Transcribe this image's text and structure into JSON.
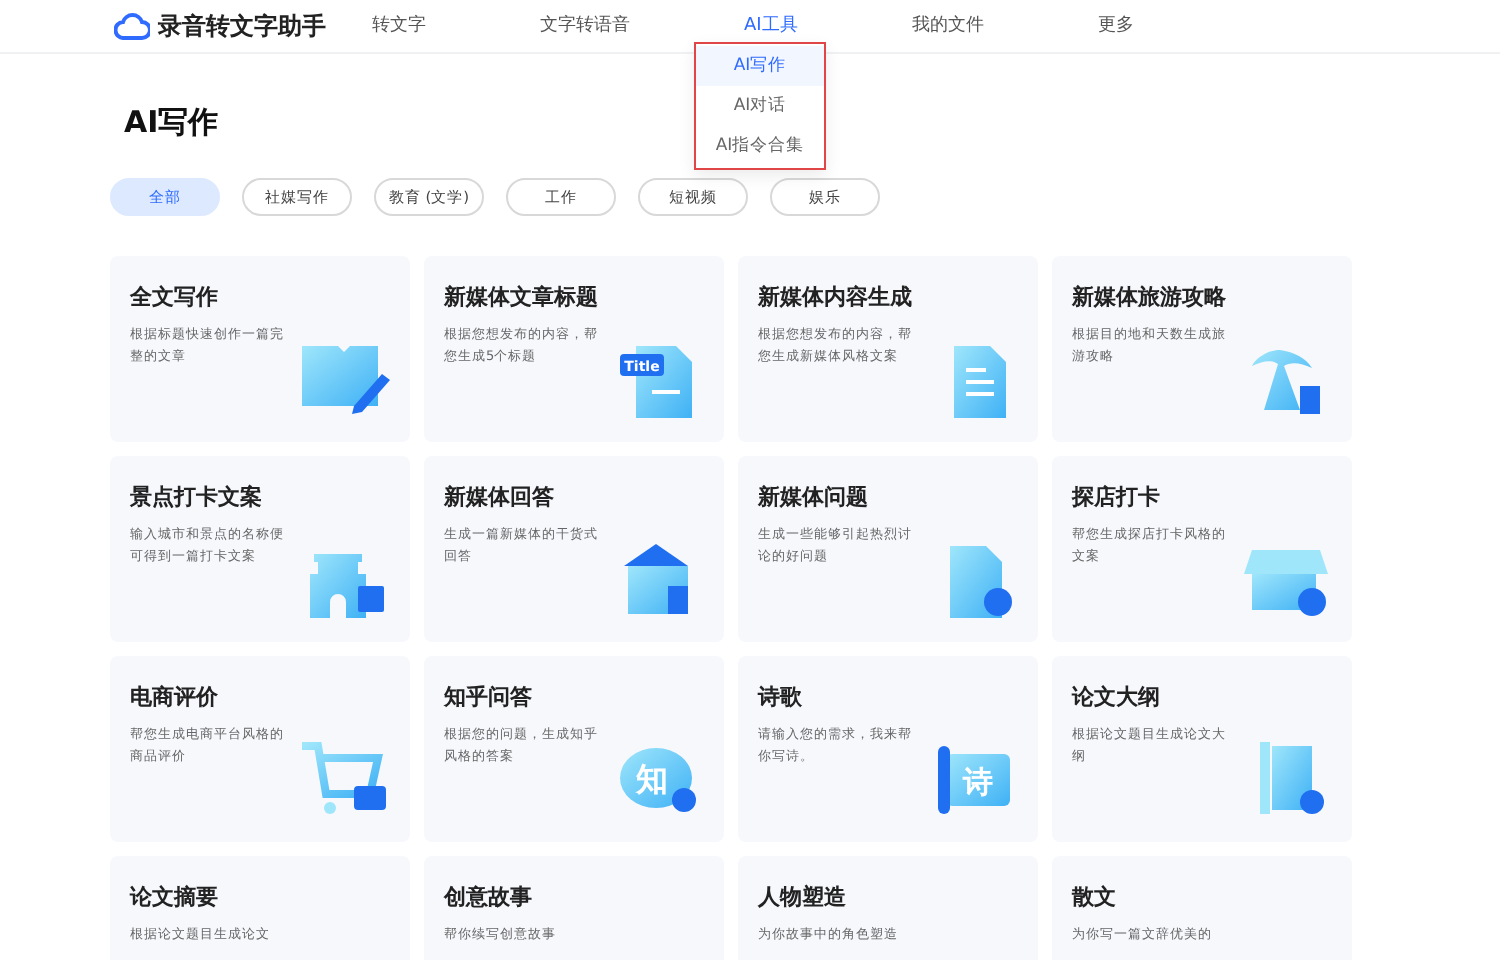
{
  "brand": {
    "name": "录音转文字助手"
  },
  "nav": [
    {
      "label": "转文字",
      "selected": false
    },
    {
      "label": "文字转语音",
      "selected": false
    },
    {
      "label": "AI工具",
      "selected": true
    },
    {
      "label": "我的文件",
      "selected": false
    },
    {
      "label": "更多",
      "selected": false
    }
  ],
  "dropdown": {
    "items": [
      {
        "label": "AI写作",
        "selected": true
      },
      {
        "label": "AI对话",
        "selected": false
      },
      {
        "label": "AI指令合集",
        "selected": false
      }
    ]
  },
  "page_title": "AI写作",
  "filters": [
    {
      "label": "全部",
      "selected": true
    },
    {
      "label": "社媒写作",
      "selected": false
    },
    {
      "label": "教育 (文学)",
      "selected": false
    },
    {
      "label": "工作",
      "selected": false
    },
    {
      "label": "短视频",
      "selected": false
    },
    {
      "label": "娱乐",
      "selected": false
    }
  ],
  "cards": [
    {
      "title": "全文写作",
      "description": "根据标题快速创作一篇完整的文章"
    },
    {
      "title": "新媒体文章标题",
      "description": "根据您想发布的内容，帮您生成5个标题",
      "icon_text": "Title"
    },
    {
      "title": "新媒体内容生成",
      "description": "根据您想发布的内容，帮您生成新媒体风格文案"
    },
    {
      "title": "新媒体旅游攻略",
      "description": "根据目的地和天数生成旅游攻略"
    },
    {
      "title": "景点打卡文案",
      "description": "输入城市和景点的名称便可得到一篇打卡文案"
    },
    {
      "title": "新媒体回答",
      "description": "生成一篇新媒体的干货式回答"
    },
    {
      "title": "新媒体问题",
      "description": "生成一些能够引起热烈讨论的好问题"
    },
    {
      "title": "探店打卡",
      "description": "帮您生成探店打卡风格的文案"
    },
    {
      "title": "电商评价",
      "description": "帮您生成电商平台风格的商品评价"
    },
    {
      "title": "知乎问答",
      "description": "根据您的问题，生成知乎风格的答案",
      "icon_text": "知"
    },
    {
      "title": "诗歌",
      "description": "请输入您的需求，我来帮你写诗。",
      "icon_text": "诗"
    },
    {
      "title": "论文大纲",
      "description": "根据论文题目生成论文大纲"
    },
    {
      "title": "论文摘要",
      "description": "根据论文题目生成论文"
    },
    {
      "title": "创意故事",
      "description": "帮你续写创意故事"
    },
    {
      "title": "人物塑造",
      "description": "为你故事中的角色塑造"
    },
    {
      "title": "散文",
      "description": "为你写一篇文辞优美的"
    }
  ]
}
